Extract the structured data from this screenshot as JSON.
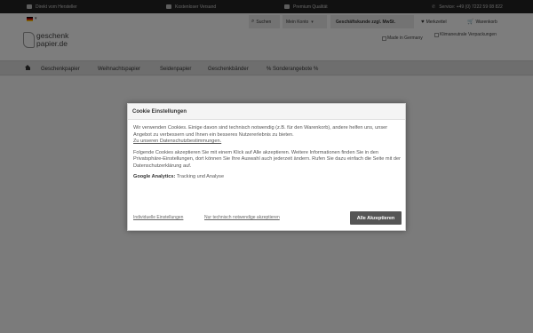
{
  "topbar": {
    "usps": [
      {
        "label": "Direkt vom Hersteller",
        "icon": "factory-icon"
      },
      {
        "label": "Kostenloser Versand",
        "icon": "truck-icon"
      },
      {
        "label": "Premium Qualität",
        "icon": "award-icon"
      }
    ],
    "service": "Service: +49 (0) 7222 59 08 822"
  },
  "header": {
    "logo_line1": "geschenk",
    "logo_line2": "papier.de",
    "search": "Suchen",
    "account": "Mein Konto",
    "business": "Geschäftskunde zzgl. MwSt.",
    "wishlist": "Merkzettel",
    "cart": "Warenkorb",
    "badge_germany": "Made in Germany",
    "badge_climate": "Klimaneutrale Verpackungen"
  },
  "mainnav": {
    "items": [
      "Geschenkpapier",
      "Weihnachtspapier",
      "Seidenpapier",
      "Geschenkbänder",
      "% Sonderangebote %"
    ]
  },
  "cookie": {
    "title": "Cookie Einstellungen",
    "p1": "Wir verwenden Cookies. Einige davon sind technisch notwendig (z.B. für den Warenkorb), andere helfen uns, unser Angebot zu verbessern und Ihnen ein besseres Nutzererlebnis zu bieten.",
    "privacy_link": "Zu unseren Datenschutzbestimmungen.",
    "p2": "Folgende Cookies akzeptieren Sie mit einem Klick auf Alle akzeptieren. Weitere Informationen finden Sie in den Privatsphäre-Einstellungen, dort können Sie Ihre Auswahl auch jederzeit ändern. Rufen Sie dazu einfach die Seite mit der Datenschutzerklärung auf.",
    "analytics_label": "Google Analytics:",
    "analytics_value": "Tracking und Analyse",
    "individual": "Individuelle Einstellungen",
    "necessary_only": "Nur technisch notwendige akzeptieren",
    "accept_all": "Alle Akzeptieren"
  }
}
